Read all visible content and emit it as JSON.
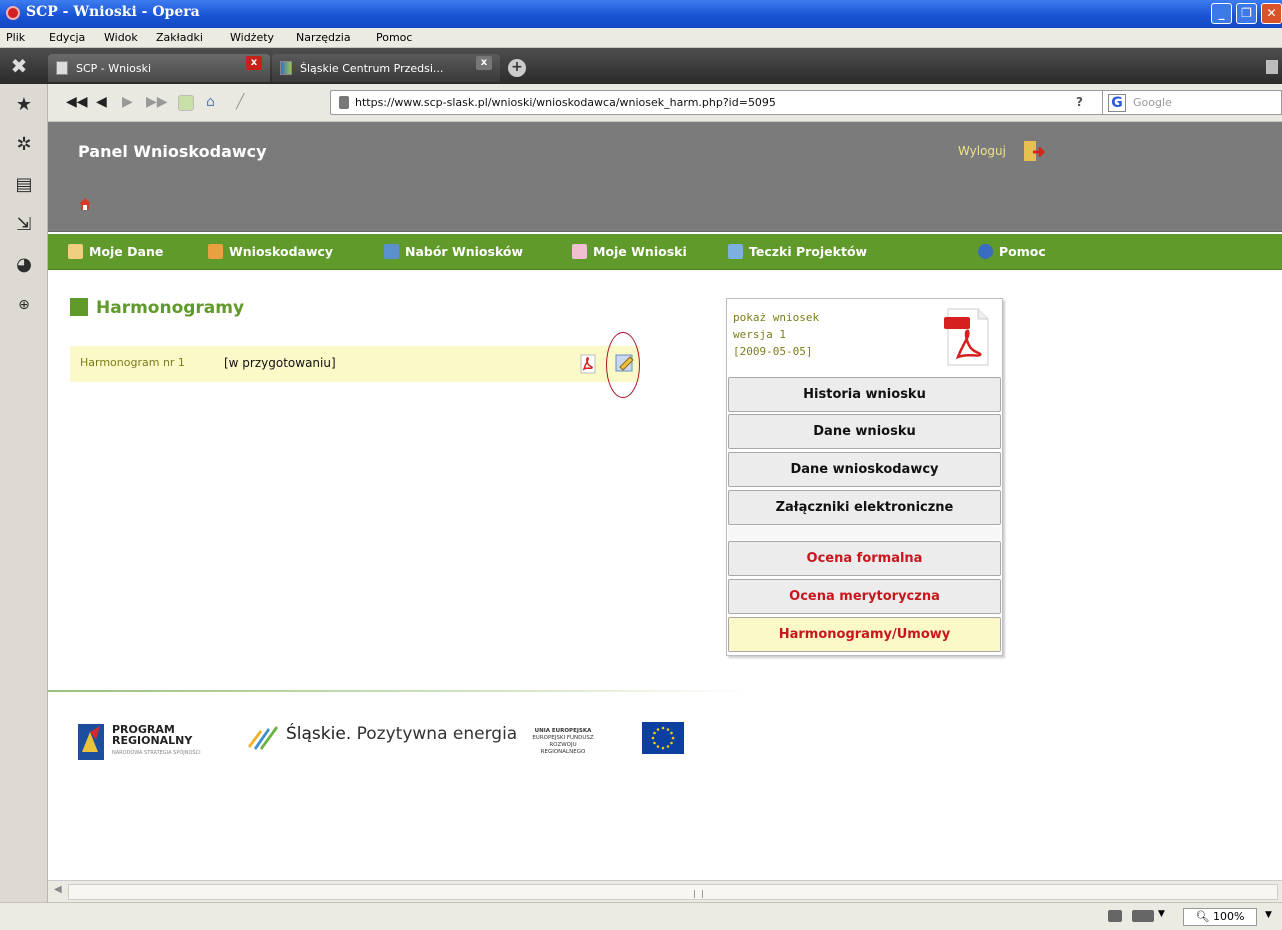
{
  "window": {
    "title": "SCP - Wnioski - Opera"
  },
  "menu": [
    "Plik",
    "Edycja",
    "Widok",
    "Zakładki",
    "Widżety",
    "Narzędzia",
    "Pomoc"
  ],
  "tabs": [
    {
      "label": "SCP - Wnioski"
    },
    {
      "label": "Śląskie Centrum Przedsi..."
    }
  ],
  "address": {
    "url": "https://www.scp-slask.pl/wnioski/wnioskodawca/wniosek_harm.php?id=5095",
    "help": "?"
  },
  "search": {
    "placeholder": "Google"
  },
  "header": {
    "title": "Panel Wnioskodawcy",
    "logout": "Wyloguj"
  },
  "nav": [
    {
      "label": "Moje Dane",
      "icon": "id-card-icon",
      "color": "#f0d080"
    },
    {
      "label": "Wnioskodawcy",
      "icon": "person-icon",
      "color": "#e8a040"
    },
    {
      "label": "Nabór Wniosków",
      "icon": "list-icon",
      "color": "#5a8fd0"
    },
    {
      "label": "Moje Wnioski",
      "icon": "edit-icon",
      "color": "#f0c0d0"
    },
    {
      "label": "Teczki Projektów",
      "icon": "folder-icon",
      "color": "#7bb0e0"
    },
    {
      "label": "Pomoc",
      "icon": "help-icon",
      "color": "#3a6cc0"
    }
  ],
  "main": {
    "heading": "Harmonogramy",
    "row": {
      "link": "Harmonogram nr 1",
      "status": "[w przygotowaniu]"
    }
  },
  "right_panel": {
    "show": "pokaż wniosek",
    "version": "wersja 1",
    "date": "[2009-05-05]",
    "buttons": [
      "Historia wniosku",
      "Dane wniosku",
      "Dane wnioskodawcy",
      "Załączniki elektroniczne"
    ],
    "red_buttons": [
      "Ocena formalna",
      "Ocena merytoryczna",
      "Harmonogramy/Umowy"
    ]
  },
  "footer": {
    "logo1_line1": "PROGRAM",
    "logo1_line2": "REGIONALNY",
    "logo1_sub": "NARODOWA STRATEGIA SPÓJNOŚCI",
    "logo2_bold": "Śląskie.",
    "logo2_rest": "Pozytywna energia",
    "logo3_l1": "UNIA EUROPEJSKA",
    "logo3_l2": "EUROPEJSKI FUNDUSZ",
    "logo3_l3": "ROZWOJU REGIONALNEGO"
  },
  "status": {
    "zoom": "100%"
  },
  "colors": {
    "green": "#5f9a2a",
    "header": "#7b7b7b",
    "accent_red": "#c8161d",
    "highlight": "#fbf9c8"
  }
}
